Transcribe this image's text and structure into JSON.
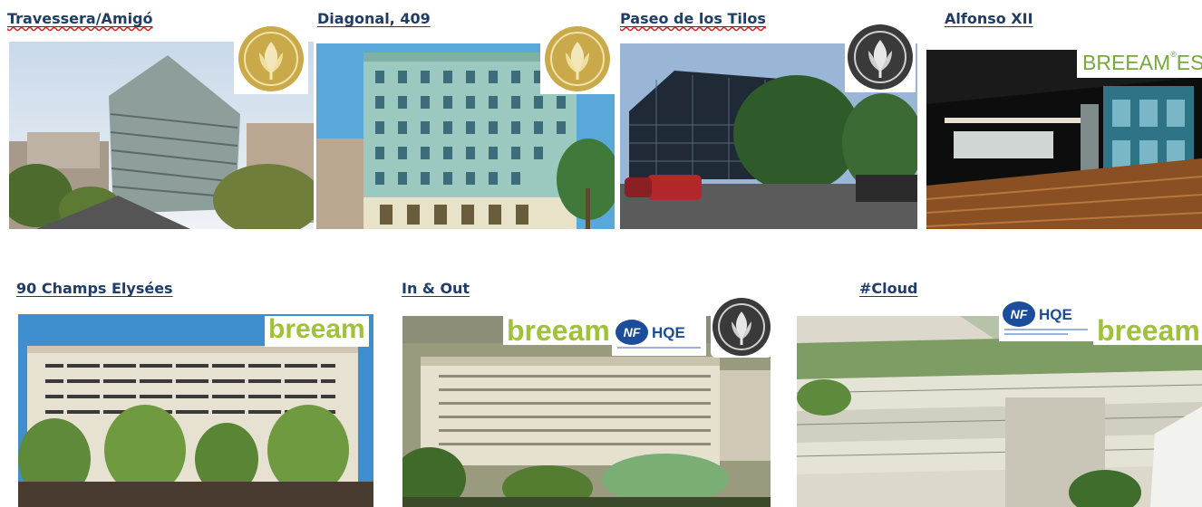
{
  "projects": [
    {
      "id": "p1",
      "name": "Travessera/Amigó",
      "certs": [
        "LEED Gold"
      ]
    },
    {
      "id": "p2",
      "name": "Diagonal, 409",
      "certs": [
        "LEED Gold"
      ]
    },
    {
      "id": "p3",
      "name": "Paseo de los Tilos",
      "certs": [
        "LEED Platinum"
      ]
    },
    {
      "id": "p4",
      "name": "Alfonso XII",
      "certs": [
        "BREEAM ES"
      ]
    },
    {
      "id": "p5",
      "name": "90 Champs Elysées",
      "certs": [
        "BREEAM"
      ]
    },
    {
      "id": "p6",
      "name": "In & Out",
      "certs": [
        "BREEAM",
        "NF HQE",
        "LEED Platinum"
      ]
    },
    {
      "id": "p7",
      "name": "#Cloud",
      "certs": [
        "NF HQE",
        "BREEAM"
      ]
    }
  ],
  "labels": {
    "breeam": "breeam",
    "breeam_es": "BREEAM",
    "breeam_es_suffix": "ES",
    "nf": "NF",
    "hqe": "HQE"
  },
  "colors": {
    "title": "#1f3d66",
    "leed_gold": "#c9a94a",
    "leed_platinum": "#3a3a3a",
    "breeam_green": "#9fc23a",
    "nf_blue": "#1b4d9a"
  }
}
